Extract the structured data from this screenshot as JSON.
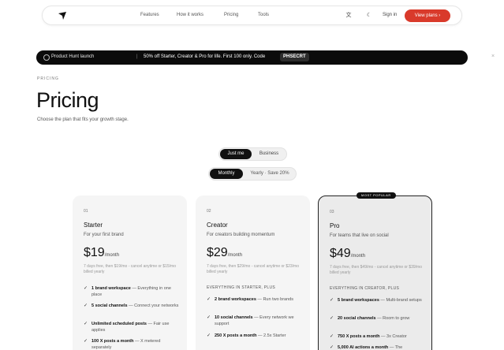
{
  "nav": {
    "links": [
      "Features",
      "How it works",
      "Pricing",
      "Tools"
    ],
    "sign_in": "Sign in",
    "cta": "View plans",
    "cta_arrow": "›",
    "theme_icons": [
      "translate-icon",
      "moon-icon"
    ]
  },
  "banner": {
    "title": "Product Hunt launch",
    "sep": "|",
    "text": "50% off Starter, Creator & Pro for life. First 100 only. Code",
    "code": "PHSECRT",
    "close": "×"
  },
  "header": {
    "eyebrow": "PRICING",
    "title": "Pricing",
    "subtitle": "Choose the plan that fits your growth stage."
  },
  "audience_toggle": {
    "options": [
      "Just me",
      "Business"
    ],
    "selected": "Just me"
  },
  "billing_toggle": {
    "options": [
      "Monthly",
      "Yearly · Save 20%"
    ],
    "selected": "Monthly"
  },
  "plans": [
    {
      "num": "01",
      "name": "Starter",
      "tagline": "For your first brand",
      "price": "$19",
      "period": "/month",
      "fine": "7 days free, then $19/mo - cancel anytime or $15/mo billed yearly",
      "plus": "",
      "features": [
        {
          "bold": "1 brand workspace",
          "rest": " — Everything in one place"
        },
        {
          "bold": "5 social channels",
          "rest": " — Connect your networks"
        },
        {
          "bold": "Unlimited scheduled posts",
          "rest": " — Fair use applies"
        },
        {
          "bold": "100 X posts a month",
          "rest": " — X metered separately"
        }
      ]
    },
    {
      "num": "02",
      "name": "Creator",
      "tagline": "For creators building momentum",
      "price": "$29",
      "period": "/month",
      "fine": "7 days free, then $29/mo - cancel anytime or $23/mo billed yearly",
      "plus": "EVERYTHING IN STARTER, PLUS",
      "features": [
        {
          "bold": "2 brand workspaces",
          "rest": " — Run two brands"
        },
        {
          "bold": "10 social channels",
          "rest": " — Every network we support"
        },
        {
          "bold": "250 X posts a month",
          "rest": " — 2.5x Starter"
        }
      ]
    },
    {
      "num": "03",
      "name": "Pro",
      "tagline": "For teams that live on social",
      "price": "$49",
      "period": "/month",
      "fine": "7 days free, then $49/mo - cancel anytime or $39/mo billed yearly",
      "plus": "EVERYTHING IN CREATOR, PLUS",
      "badge": "MOST POPULAR",
      "features": [
        {
          "bold": "5 brand workspaces",
          "rest": " — Multi-brand setups"
        },
        {
          "bold": "20 social channels",
          "rest": " — Room to grow"
        },
        {
          "bold": "750 X posts a month",
          "rest": " — 3x Creator"
        },
        {
          "bold": "5,000 AI actions a month",
          "rest": " — The"
        }
      ]
    }
  ],
  "icons": {
    "check": "✓",
    "close": "×"
  },
  "colors": {
    "accent": "#d93a2b",
    "dark": "#0b0b0b"
  }
}
